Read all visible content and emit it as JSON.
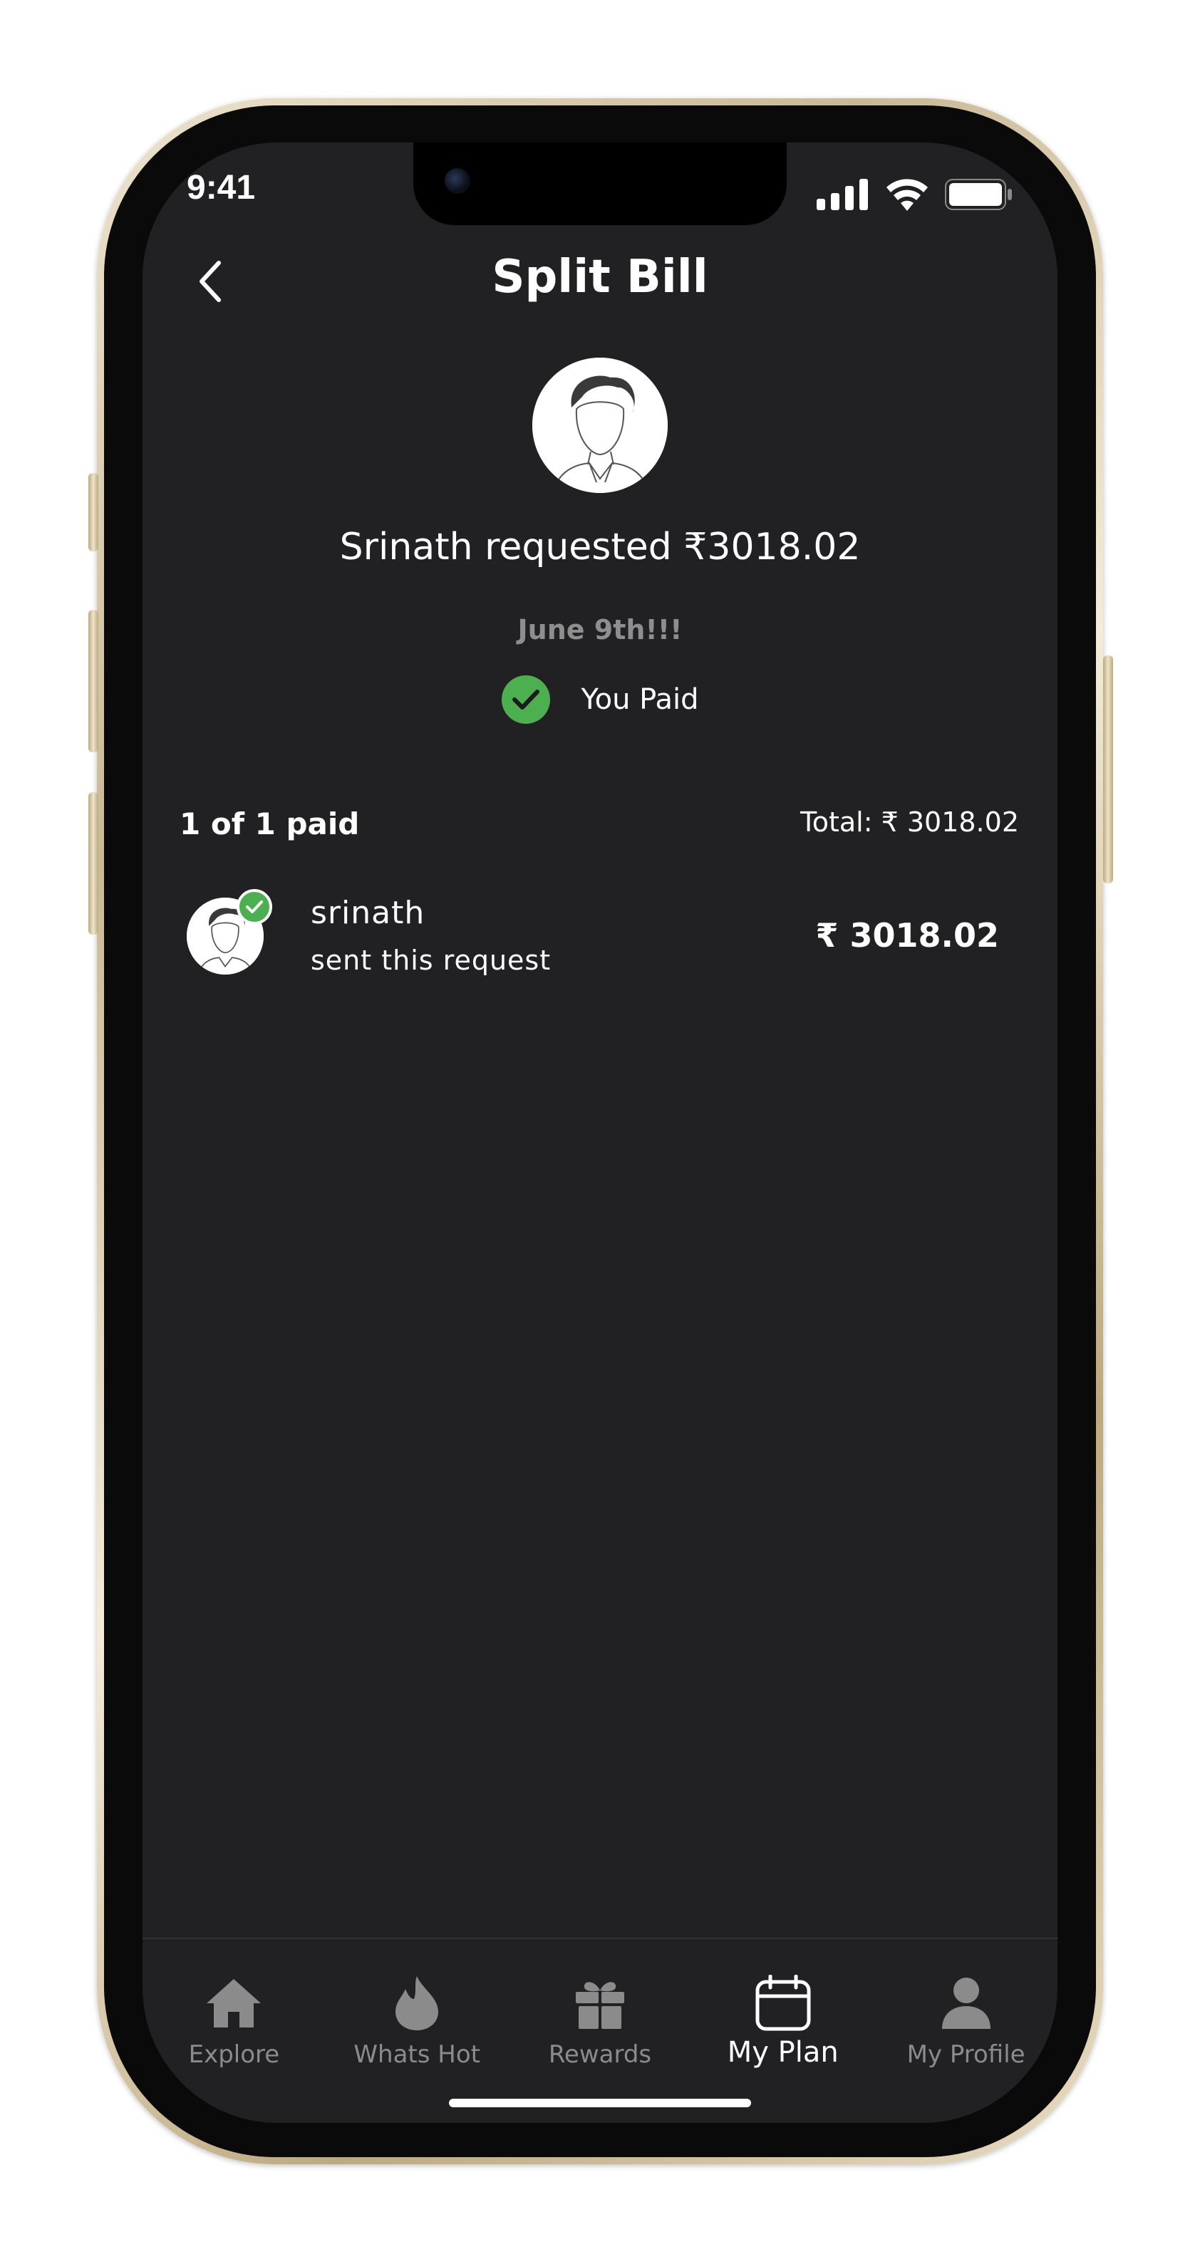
{
  "status_bar": {
    "time": "9:41",
    "icons": [
      "signal-icon",
      "wifi-icon",
      "battery-icon"
    ]
  },
  "header": {
    "title": "Split Bill",
    "back_icon": "chevron-left-icon"
  },
  "request": {
    "headline": "Srinath requested ₹3018.02",
    "date": "June 9th!!!",
    "status": "You Paid"
  },
  "summary": {
    "paid_count": "1 of 1 paid",
    "total": "Total: ₹ 3018.02"
  },
  "participants": [
    {
      "name": "srinath",
      "subtitle": "sent this request",
      "amount": "₹ 3018.02"
    }
  ],
  "tabs": [
    {
      "label": "Explore",
      "icon": "home-icon",
      "active": false
    },
    {
      "label": "Whats Hot",
      "icon": "flame-icon",
      "active": false
    },
    {
      "label": "Rewards",
      "icon": "gift-icon",
      "active": false
    },
    {
      "label": "My Plan",
      "icon": "calendar-icon",
      "active": true
    },
    {
      "label": "My Profile",
      "icon": "person-icon",
      "active": false
    }
  ],
  "colors": {
    "background": "#212123",
    "success": "#4caf50",
    "text_primary": "#ffffff",
    "text_muted": "#8e8e8e",
    "tab_inactive": "#8b8b8b"
  }
}
